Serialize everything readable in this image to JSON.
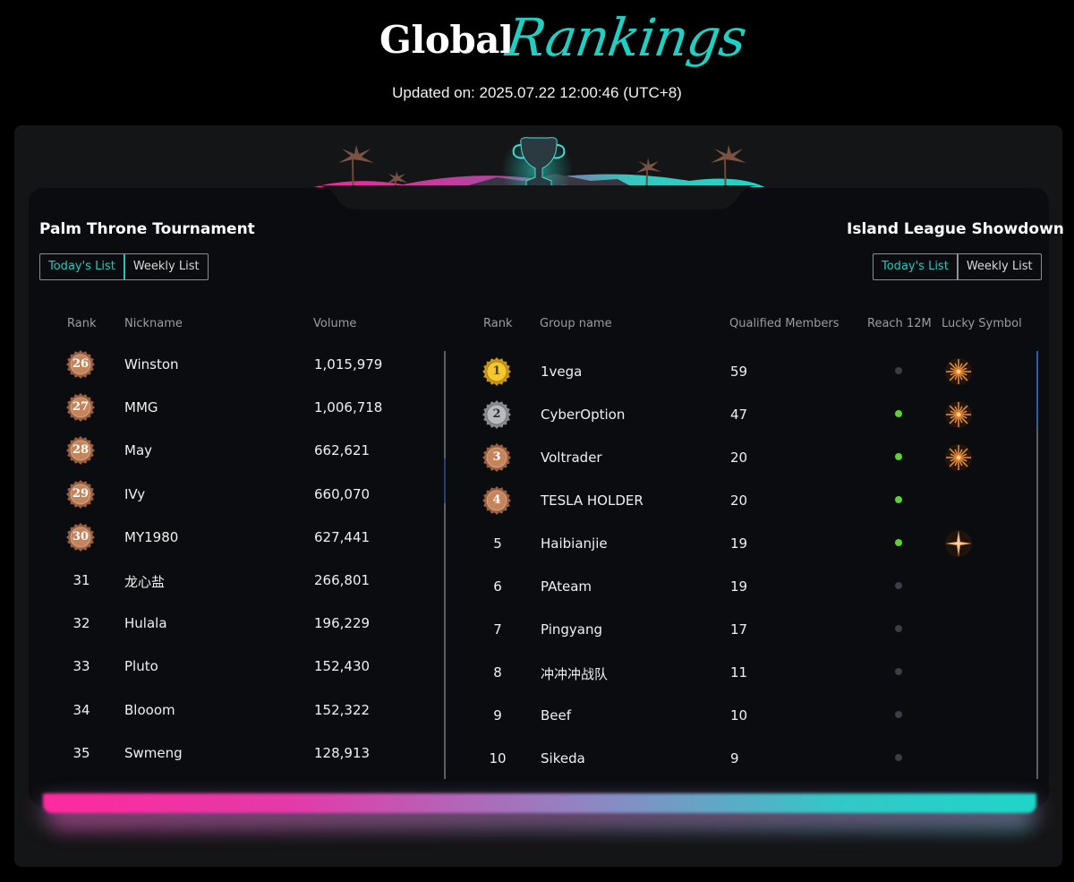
{
  "header": {
    "title_part1": "Global",
    "title_part2": "Rankings",
    "updated": "Updated on: 2025.07.22 12:00:46 (UTC+8)"
  },
  "left": {
    "title": "Palm Throne Tournament",
    "tabs": [
      "Today's List",
      "Weekly List"
    ],
    "active_tab": "Today's List",
    "columns": [
      "Rank",
      "Nickname",
      "Volume"
    ],
    "rows": [
      {
        "rank": "26",
        "name": "Winston",
        "volume": "1,015,979",
        "medal": true
      },
      {
        "rank": "27",
        "name": "MMG",
        "volume": "1,006,718",
        "medal": true
      },
      {
        "rank": "28",
        "name": "May",
        "volume": "662,621",
        "medal": true
      },
      {
        "rank": "29",
        "name": "IVy",
        "volume": "660,070",
        "medal": true
      },
      {
        "rank": "30",
        "name": "MY1980",
        "volume": "627,441",
        "medal": true
      },
      {
        "rank": "31",
        "name": "龙心盐",
        "volume": "266,801",
        "medal": false
      },
      {
        "rank": "32",
        "name": "Hulala",
        "volume": "196,229",
        "medal": false
      },
      {
        "rank": "33",
        "name": "Pluto",
        "volume": "152,430",
        "medal": false
      },
      {
        "rank": "34",
        "name": "Blooom",
        "volume": "152,322",
        "medal": false
      },
      {
        "rank": "35",
        "name": "Swmeng",
        "volume": "128,913",
        "medal": false
      }
    ]
  },
  "right": {
    "title": "Island League Showdown",
    "tabs": [
      "Today's List",
      "Weekly List"
    ],
    "active_tab": "Today's List",
    "columns": [
      "Rank",
      "Group name",
      "Qualified Members",
      "Reach 12M",
      "Lucky Symbol"
    ],
    "rows": [
      {
        "rank": "1",
        "name": "1vega",
        "members": "59",
        "reach": false,
        "lucky": "sun-burst-icon",
        "medal": "gold"
      },
      {
        "rank": "2",
        "name": "CyberOption",
        "members": "47",
        "reach": true,
        "lucky": "sun-burst-icon",
        "medal": "silver"
      },
      {
        "rank": "3",
        "name": "Voltrader",
        "members": "20",
        "reach": true,
        "lucky": "sun-burst-icon",
        "medal": "bronze"
      },
      {
        "rank": "4",
        "name": "TESLA HOLDER",
        "members": "20",
        "reach": true,
        "lucky": "",
        "medal": "bronze"
      },
      {
        "rank": "5",
        "name": "Haibianjie",
        "members": "19",
        "reach": true,
        "lucky": "star-spark-icon",
        "medal": ""
      },
      {
        "rank": "6",
        "name": "PAteam",
        "members": "19",
        "reach": false,
        "lucky": "",
        "medal": ""
      },
      {
        "rank": "7",
        "name": "Pingyang",
        "members": "17",
        "reach": false,
        "lucky": "",
        "medal": ""
      },
      {
        "rank": "8",
        "name": "冲冲冲战队",
        "members": "11",
        "reach": false,
        "lucky": "",
        "medal": ""
      },
      {
        "rank": "9",
        "name": "Beef",
        "members": "10",
        "reach": false,
        "lucky": "",
        "medal": ""
      },
      {
        "rank": "10",
        "name": "Sikeda",
        "members": "9",
        "reach": false,
        "lucky": "",
        "medal": ""
      }
    ]
  },
  "colors": {
    "accent": "#22c9bd",
    "reach_on": "#5fd12a",
    "reach_off": "#3b3e48",
    "gold": "#e8b923",
    "silver": "#a9aab0",
    "bronze": "#b87a55"
  }
}
